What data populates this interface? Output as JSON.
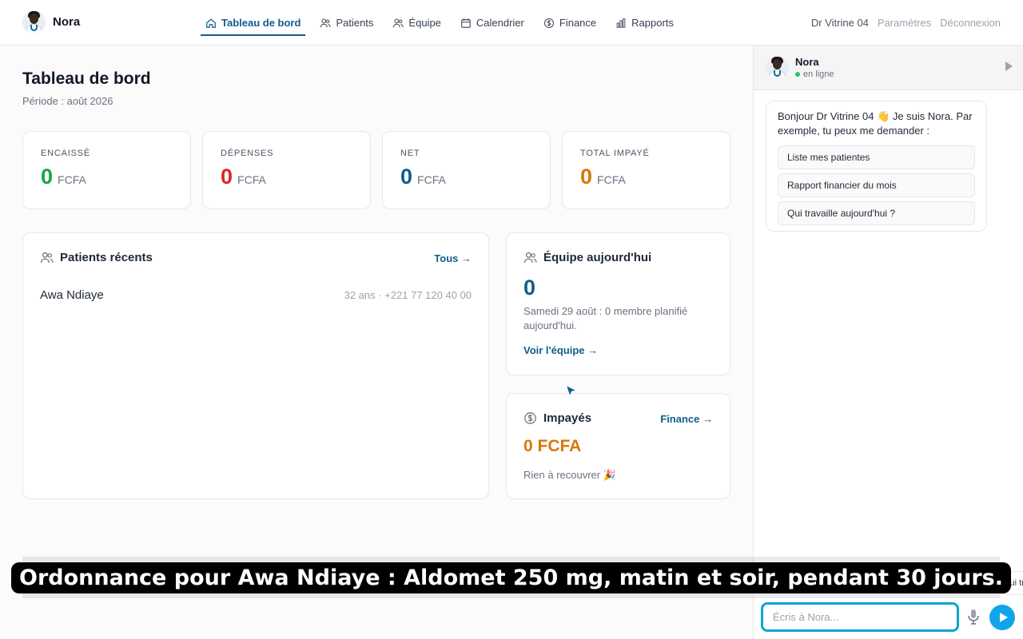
{
  "brand": {
    "name": "Nora"
  },
  "nav": {
    "items": [
      {
        "label": "Tableau de bord",
        "icon": "home-icon",
        "active": true
      },
      {
        "label": "Patients",
        "icon": "users-icon",
        "active": false
      },
      {
        "label": "Équipe",
        "icon": "team-icon",
        "active": false
      },
      {
        "label": "Calendrier",
        "icon": "calendar-icon",
        "active": false
      },
      {
        "label": "Finance",
        "icon": "dollar-icon",
        "active": false
      },
      {
        "label": "Rapports",
        "icon": "chart-icon",
        "active": false
      }
    ]
  },
  "user": {
    "name": "Dr Vitrine 04",
    "settings": "Paramètres",
    "logout": "Déconnexion"
  },
  "dashboard": {
    "title": "Tableau de bord",
    "period": "Période : août 2026",
    "stats": [
      {
        "label": "ENCAISSÉ",
        "value": "0",
        "currency": "FCFA",
        "color": "#16a34a"
      },
      {
        "label": "DÉPENSES",
        "value": "0",
        "currency": "FCFA",
        "color": "#dc2626"
      },
      {
        "label": "NET",
        "value": "0",
        "currency": "FCFA",
        "color": "#0f5e8c"
      },
      {
        "label": "TOTAL IMPAYÉ",
        "value": "0",
        "currency": "FCFA",
        "color": "#d97706"
      }
    ],
    "recent_patients": {
      "title": "Patients récents",
      "link": "Tous →",
      "rows": [
        {
          "name": "Awa Ndiaye",
          "meta": "32 ans · +221 77 120 40 00"
        }
      ]
    },
    "team_today": {
      "title": "Équipe aujourd'hui",
      "count": "0",
      "description": "Samedi 29 août : 0 membre planifié aujourd'hui.",
      "link": "Voir l'équipe →"
    },
    "unpaid": {
      "title": "Impayés",
      "link": "Finance →",
      "amount": "0 FCFA",
      "note": "Rien à recouvrer 🎉"
    }
  },
  "chat": {
    "name": "Nora",
    "status": "en ligne",
    "greeting": "Bonjour Dr Vitrine 04 👋 Je suis Nora. Par exemple, tu peux me demander :",
    "suggestions": [
      "Liste mes patientes",
      "Rapport financier du mois",
      "Qui travaille aujourd'hui ?"
    ],
    "peek_chip": "Qui tr",
    "input_placeholder": "Écris à Nora...",
    "input_value": ""
  },
  "caption": "Ordonnance pour Awa Ndiaye : Aldomet 250 mg, matin et soir, pendant 30 jours.",
  "colors": {
    "accent": "#0f5e8c",
    "send": "#0ea5e9",
    "unpaid": "#d97706"
  }
}
